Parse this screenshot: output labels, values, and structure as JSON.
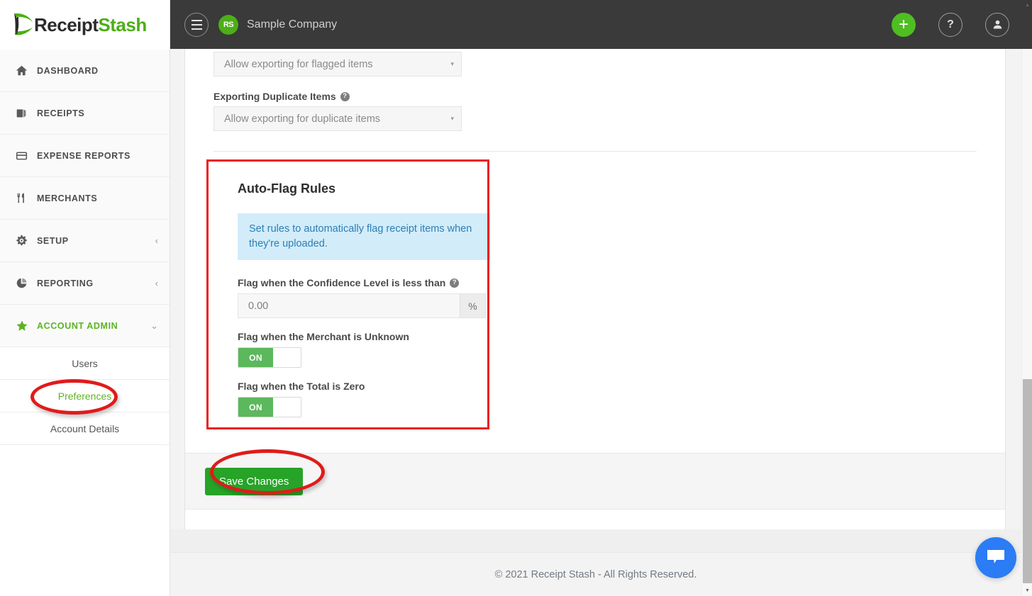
{
  "brand": {
    "logo_primary": "Receipt",
    "logo_secondary": "Stash",
    "accent_green": "#4caf16",
    "avatar_initials": "RS"
  },
  "header": {
    "menu_icon": "hamburger-icon",
    "company_name": "Sample Company",
    "add_label": "+",
    "help_label": "?",
    "account_icon": "user-icon"
  },
  "sidebar": {
    "items": [
      {
        "label": "DASHBOARD",
        "icon": "home-icon",
        "caret": ""
      },
      {
        "label": "RECEIPTS",
        "icon": "receipts-icon",
        "caret": ""
      },
      {
        "label": "EXPENSE REPORTS",
        "icon": "card-icon",
        "caret": ""
      },
      {
        "label": "MERCHANTS",
        "icon": "cutlery-icon",
        "caret": ""
      },
      {
        "label": "SETUP",
        "icon": "gear-icon",
        "caret": "‹"
      },
      {
        "label": "REPORTING",
        "icon": "pie-chart-icon",
        "caret": "‹"
      },
      {
        "label": "ACCOUNT ADMIN",
        "icon": "star-icon",
        "caret": "⌄"
      }
    ],
    "subitems": [
      {
        "label": "Users"
      },
      {
        "label": "Preferences"
      },
      {
        "label": "Account Details"
      }
    ]
  },
  "main": {
    "export_flagged": {
      "value": "Allow exporting for flagged items",
      "caret": "▾"
    },
    "export_duplicate": {
      "label": "Exporting Duplicate Items",
      "help": "?",
      "value": "Allow exporting for duplicate items",
      "caret": "▾"
    },
    "autoflag": {
      "title": "Auto-Flag Rules",
      "info": "Set rules to automatically flag receipt items when they're uploaded.",
      "confidence_label": "Flag when the Confidence Level is less than",
      "confidence_help": "?",
      "confidence_value": "0.00",
      "confidence_placeholder": "0.00",
      "percent_addon": "%",
      "merchant_label": "Flag when the Merchant is Unknown",
      "merchant_state": "ON",
      "total_label": "Flag when the Total is Zero",
      "total_state": "ON"
    },
    "save_label": "Save Changes"
  },
  "footer": {
    "copyright": "© 2021 Receipt Stash - All Rights Reserved."
  },
  "chat": {
    "icon": "chat-bubble-icon"
  },
  "scrollbar": {
    "up_arrow": "▲",
    "down_arrow": "▼"
  }
}
